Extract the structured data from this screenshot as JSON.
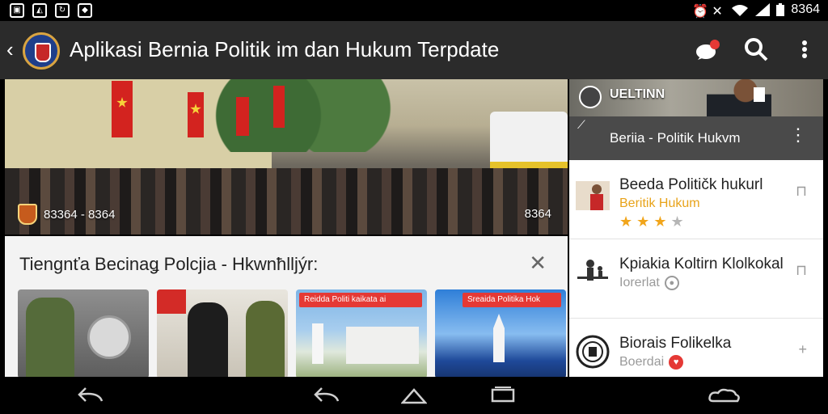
{
  "status_bar": {
    "left_icons": [
      "gallery-icon",
      "app-icon",
      "sync-icon",
      "notification-icon"
    ],
    "right_icons": [
      "alarm-icon",
      "mute-icon",
      "wifi-icon",
      "signal-icon",
      "battery-icon"
    ],
    "time": "8364"
  },
  "app_bar": {
    "title": "Aplikasi Bernia Politik im dan Hukum Terpdate",
    "actions": [
      "chat-icon",
      "search-icon",
      "more-icon"
    ]
  },
  "hero": {
    "caption_left": "83364 - 8364",
    "caption_right": "8364"
  },
  "section": {
    "title": "Tiengnťa Becinaǥ Polcjia - Hkwnħlljýr:",
    "close_label": "✕",
    "thumbnails": [
      {
        "banner": ""
      },
      {
        "banner": ""
      },
      {
        "banner": "Reidda Politi kaikata ai"
      },
      {
        "banner": "Sreaida Politika Hok"
      }
    ]
  },
  "right_panel": {
    "header_text": "UELTINN",
    "subheader_title": "Beriia - Politik Hukvm",
    "items": [
      {
        "title": "Beeda Političk hukurl",
        "subtitle": "Beritik Hukum",
        "subtitle_color": "#e8a31a",
        "rating": 3,
        "rating_max": 4
      },
      {
        "title": "Kpiakia Koltirn Klolkokal",
        "subtitle": "Iorerlat",
        "subtitle_color": "#9a9a9a"
      },
      {
        "title": "Biorais Folikelka",
        "subtitle": "Boerdai",
        "subtitle_color": "#9a9a9a"
      }
    ]
  },
  "nav_bar": {
    "buttons": [
      "back",
      "back",
      "home",
      "recents",
      "cloud"
    ]
  }
}
